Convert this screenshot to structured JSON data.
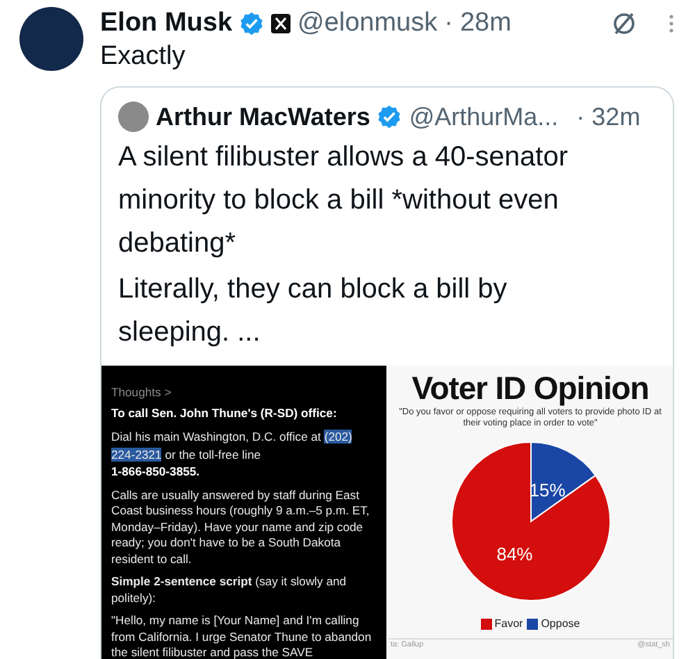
{
  "post": {
    "author": "Elon Musk",
    "verified": true,
    "handle": "@elonmusk",
    "separator": "·",
    "time": "28m",
    "text": "Exactly"
  },
  "quote": {
    "author": "Arthur MacWaters",
    "verified": true,
    "handle": "@ArthurMa...",
    "separator": "·",
    "time": "32m",
    "paragraphs": [
      "A silent filibuster allows a 40-senator minority to block a bill *without even debating*",
      "Literally, they can block a bill by sleeping. ..."
    ],
    "media": [
      {
        "kind": "screenshot",
        "link": "Thoughts >",
        "heading": "To call Sen. John Thune's (R-SD) office:",
        "dial_before": "Dial his main Washington, D.C. office at ",
        "dial_selected": "(202) 224-2321",
        "dial_after": " or the toll-free line",
        "toll_free": "1-866-850-3855.",
        "paragraphs": [
          "Calls are usually answered by staff during East Coast business hours (roughly 9 a.m.–5 p.m. ET, Monday–Friday). Have your name and zip code ready; you don't have to be a South Dakota resident to call.",
          "**Simple 2-sentence script** (say it slowly and politely):",
          "\"Hello, my name is [Your Name] and I'm calling from California. I urge Senator Thune to abandon the silent filibuster and pass the SAVE"
        ]
      },
      {
        "kind": "chart",
        "title": "Voter ID Opinion",
        "subtitle": "\"Do you favor or oppose requiring all voters to provide photo ID at their voting place in order to vote\"",
        "source": "ta: Gallup",
        "credit": "@stat_sh",
        "chart_data": {
          "type": "pie",
          "categories": [
            "Favor",
            "Oppose"
          ],
          "values": [
            84,
            15
          ],
          "colors": [
            "#d40d0d",
            "#1a46a6"
          ],
          "value_labels": [
            "84%",
            "15%"
          ]
        }
      }
    ]
  }
}
